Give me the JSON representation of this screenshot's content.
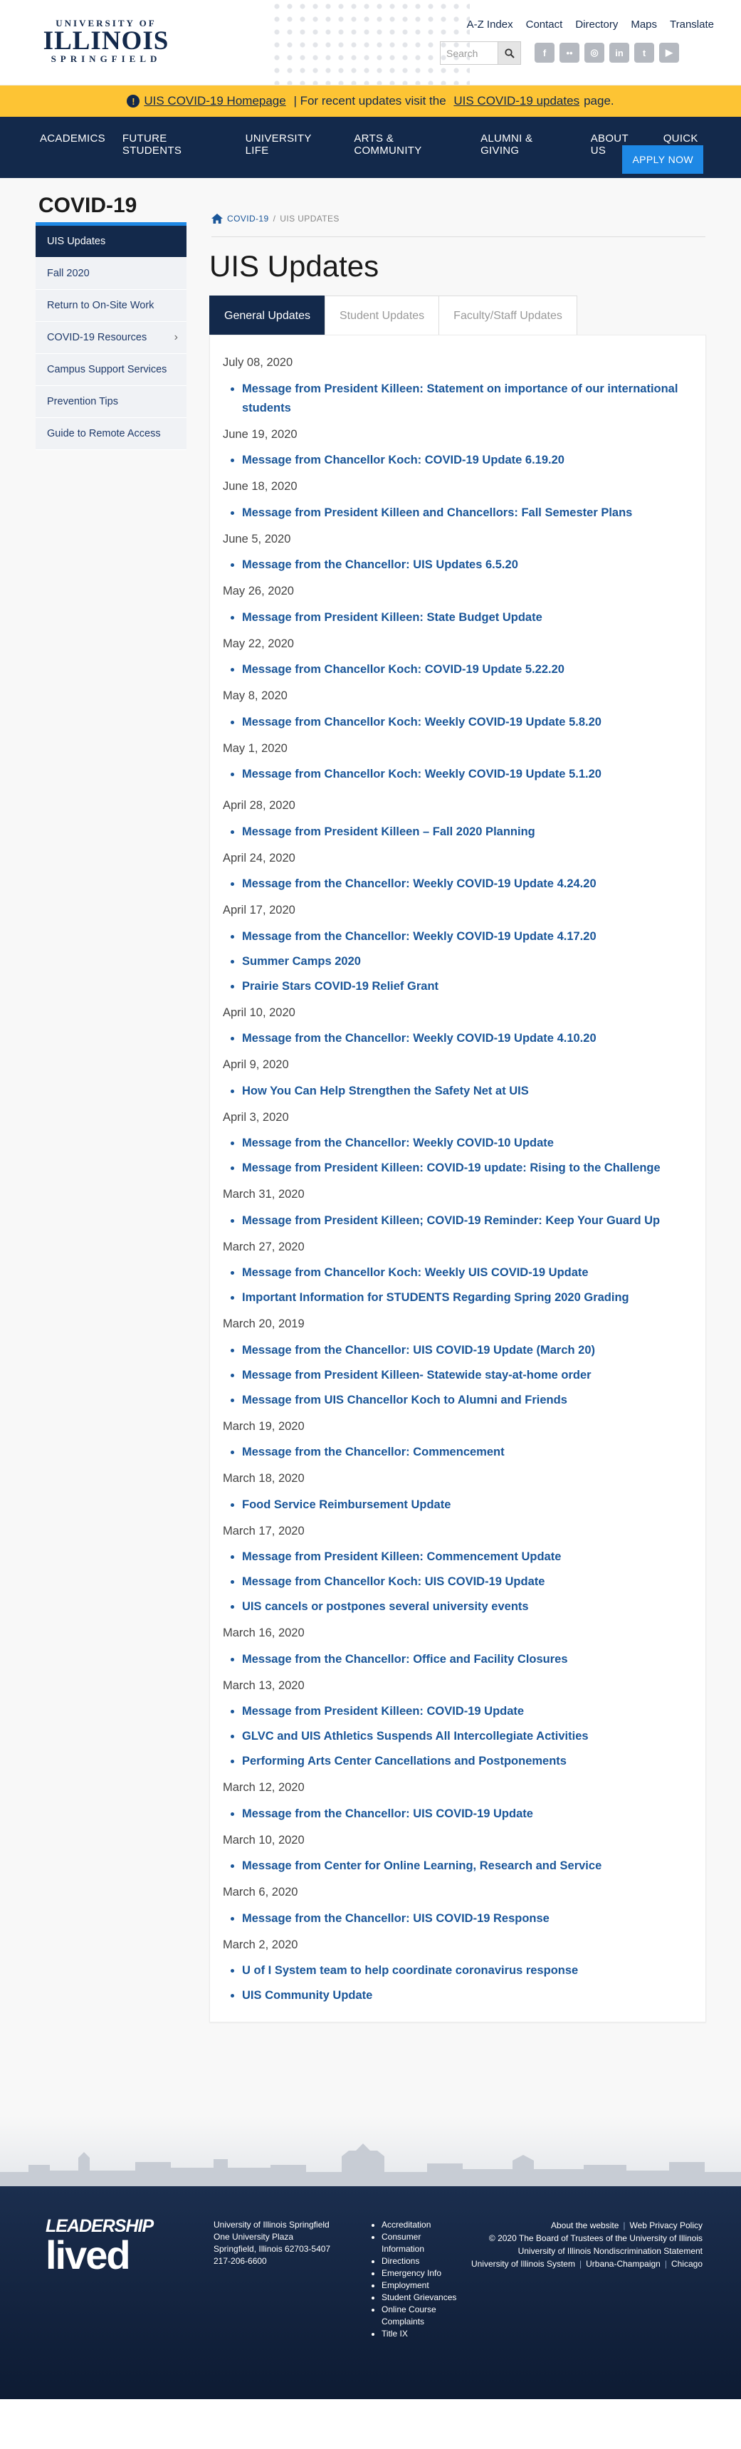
{
  "header": {
    "logo": {
      "line1": "UNIVERSITY OF",
      "line2": "ILLINOIS",
      "line3": "SPRINGFIELD"
    },
    "util_links": [
      "A-Z Index",
      "Contact",
      "Directory",
      "Maps",
      "Translate"
    ],
    "search_placeholder": "Search",
    "social_icons": [
      "facebook-icon",
      "flickr-icon",
      "instagram-icon",
      "linkedin-icon",
      "twitter-icon",
      "youtube-icon"
    ]
  },
  "alert": {
    "link1": "UIS COVID-19 Homepage",
    "middle": " | For recent updates visit the ",
    "link2": "UIS COVID-19 updates",
    "end": " page."
  },
  "mainnav": {
    "items": [
      "ACADEMICS",
      "FUTURE STUDENTS",
      "UNIVERSITY LIFE",
      "ARTS & COMMUNITY",
      "ALUMNI & GIVING",
      "ABOUT US",
      "QUICK LINKS"
    ],
    "apply": "APPLY NOW"
  },
  "sidebar": {
    "title": "COVID-19",
    "items": [
      "UIS Updates",
      "Fall 2020",
      "Return to On-Site Work",
      "COVID-19 Resources",
      "Campus Support Services",
      "Prevention Tips",
      "Guide to Remote Access"
    ]
  },
  "breadcrumb": {
    "link": "COVID-19",
    "sep": "/",
    "current": "UIS UPDATES"
  },
  "page": {
    "title": "UIS Updates"
  },
  "tabs": [
    "General Updates",
    "Student Updates",
    "Faculty/Staff Updates"
  ],
  "updates": [
    {
      "date": "July 08, 2020",
      "items": [
        "Message from President Killeen: Statement on importance of our international students"
      ]
    },
    {
      "date": "June 19, 2020",
      "items": [
        "Message from Chancellor Koch: COVID-19 Update 6.19.20"
      ]
    },
    {
      "date": "June 18, 2020",
      "items": [
        "Message from President Killeen and Chancellors: Fall Semester Plans"
      ]
    },
    {
      "date": "June 5, 2020",
      "items": [
        "Message from the Chancellor: UIS Updates 6.5.20"
      ]
    },
    {
      "date": "May 26, 2020",
      "items": [
        "Message from President Killeen: State Budget Update"
      ]
    },
    {
      "date": "May 22, 2020",
      "items": [
        "Message from Chancellor Koch: COVID-19 Update 5.22.20"
      ]
    },
    {
      "date": "May 8, 2020",
      "items": [
        "Message from Chancellor Koch: Weekly COVID-19 Update 5.8.20"
      ]
    },
    {
      "date": "May 1, 2020",
      "items": [
        "Message from Chancellor Koch: Weekly COVID-19 Update 5.1.20"
      ]
    },
    {
      "date": "April 28, 2020",
      "items": [
        "Message from President Killeen – Fall 2020 Planning"
      ]
    },
    {
      "date": "April 24, 2020",
      "items": [
        "Message from the Chancellor: Weekly COVID-19 Update 4.24.20"
      ]
    },
    {
      "date": "April 17, 2020",
      "items": [
        "Message from the Chancellor: Weekly COVID-19 Update 4.17.20",
        "Summer Camps 2020",
        "Prairie Stars COVID-19 Relief Grant"
      ]
    },
    {
      "date": "April 10, 2020",
      "items": [
        "Message from the Chancellor: Weekly COVID-19 Update 4.10.20"
      ]
    },
    {
      "date": "April 9, 2020",
      "items": [
        "How You Can Help Strengthen the Safety Net at UIS"
      ]
    },
    {
      "date": "April 3, 2020",
      "items": [
        "Message from the Chancellor: Weekly COVID-10 Update",
        "Message from President Killeen: COVID-19 update: Rising to the Challenge"
      ]
    },
    {
      "date": "March 31, 2020",
      "items": [
        "Message from President Killeen; COVID-19 Reminder: Keep Your Guard Up"
      ]
    },
    {
      "date": "March 27, 2020",
      "items": [
        "Message from Chancellor Koch: Weekly UIS COVID-19 Update",
        "Important Information for STUDENTS Regarding Spring 2020 Grading"
      ]
    },
    {
      "date": "March 20, 2019",
      "items": [
        "Message from the Chancellor: UIS COVID-19 Update (March 20)",
        "Message from President Killeen- Statewide stay-at-home order",
        "Message from UIS Chancellor Koch to Alumni and Friends"
      ]
    },
    {
      "date": "March 19, 2020",
      "items": [
        "Message from the Chancellor: Commencement"
      ]
    },
    {
      "date": "March 18, 2020",
      "items": [
        "Food Service Reimbursement Update"
      ]
    },
    {
      "date": "March 17, 2020",
      "items": [
        "Message from President Killeen: Commencement Update",
        "Message from Chancellor Koch: UIS COVID-19 Update",
        "UIS cancels or postpones several university events"
      ]
    },
    {
      "date": "March 16, 2020",
      "items": [
        "Message from the Chancellor: Office and Facility Closures"
      ]
    },
    {
      "date": "March 13, 2020",
      "items": [
        "Message from President Killeen: COVID-19 Update",
        "GLVC and UIS Athletics Suspends All Intercollegiate Activities",
        "Performing Arts Center Cancellations and Postponements"
      ]
    },
    {
      "date": "March 12, 2020",
      "items": [
        "Message from the Chancellor: UIS COVID-19 Update"
      ]
    },
    {
      "date": "March 10, 2020",
      "items": [
        "Message from Center for Online Learning, Research and Service"
      ]
    },
    {
      "date": "March 6, 2020",
      "items": [
        "Message from the Chancellor: UIS COVID-19 Response"
      ]
    },
    {
      "date": "March 2, 2020",
      "items": [
        "U of I System team to help coordinate coronavirus response",
        "UIS Community Update"
      ]
    }
  ],
  "footer": {
    "lead1": "LEADERSHIP",
    "lead2": "lived",
    "address": [
      "University of Illinois Springfield",
      "One University Plaza",
      "Springfield, Illinois 62703-5407",
      "217-206-6600"
    ],
    "links": [
      "Accreditation",
      "Consumer Information",
      "Directions",
      "Emergency Info",
      "Employment",
      "Student Grievances",
      "Online Course Complaints",
      "Title IX"
    ],
    "legal_line1": [
      "About the website",
      "Web Privacy Policy"
    ],
    "legal_line2": "© 2020 The Board of Trustees of the University of Illinois",
    "legal_line3": "University of Illinois Nondiscrimination Statement",
    "legal_line4": [
      "University of Illinois System",
      "Urbana-Champaign",
      "Chicago"
    ]
  },
  "colors": {
    "navy": "#13294b",
    "gold": "#fdc434",
    "link": "#1a5699",
    "apply": "#1e88e5"
  }
}
